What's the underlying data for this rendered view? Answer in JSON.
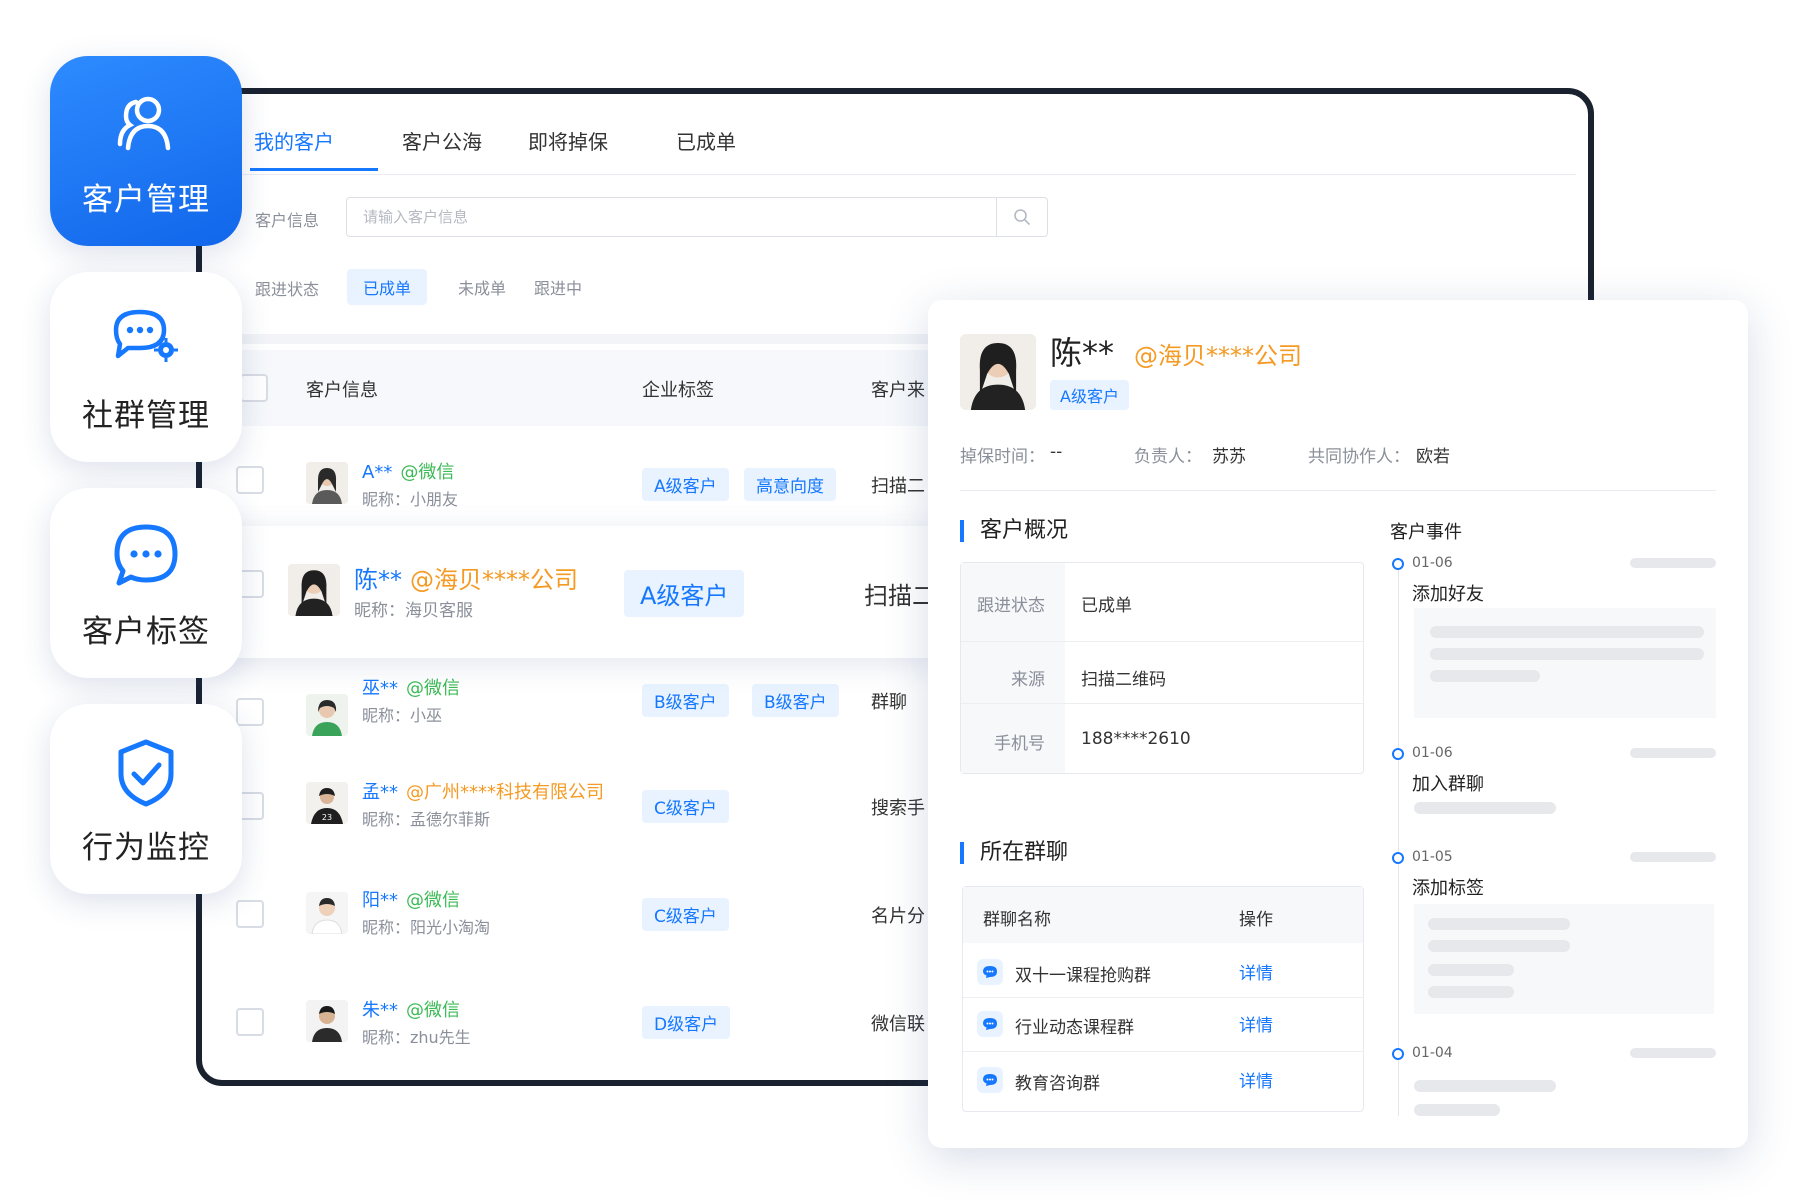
{
  "nav": {
    "items": [
      {
        "label": "客户管理",
        "icon": "customer-manage-icon",
        "active": true
      },
      {
        "label": "社群管理",
        "icon": "community-chat-icon",
        "active": false
      },
      {
        "label": "客户标签",
        "icon": "chat-bubble-icon",
        "active": false
      },
      {
        "label": "行为监控",
        "icon": "shield-check-icon",
        "active": false
      }
    ]
  },
  "tabs": [
    "我的客户",
    "客户公海",
    "即将掉保",
    "已成单"
  ],
  "search": {
    "label": "客户信息",
    "placeholder": "请输入客户信息"
  },
  "filter": {
    "label": "跟进状态",
    "options": [
      "已成单",
      "未成单",
      "跟进中"
    ]
  },
  "table": {
    "headers": [
      "客户信息",
      "企业标签",
      "客户来"
    ],
    "rows": [
      {
        "name": "A**",
        "source": "@微信",
        "nickname": "昵称：小朋友",
        "tags": [
          "A级客户",
          "高意向度"
        ],
        "channel": "扫描二"
      },
      {
        "name": "陈**",
        "source": "@海贝****公司",
        "nickname": "昵称：海贝客服",
        "tags": [
          "A级客户"
        ],
        "channel": "扫描二"
      },
      {
        "name": "巫**",
        "source": "@微信",
        "nickname": "昵称：小巫",
        "tags": [
          "B级客户",
          "B级客户"
        ],
        "channel": "群聊"
      },
      {
        "name": "孟**",
        "source": "@广州****科技有限公司",
        "nickname": "昵称：孟德尔菲斯",
        "tags": [
          "C级客户"
        ],
        "channel": "搜索手"
      },
      {
        "name": "阳**",
        "source": "@微信",
        "nickname": "昵称：阳光小淘淘",
        "tags": [
          "C级客户"
        ],
        "channel": "名片分"
      },
      {
        "name": "朱**",
        "source": "@微信",
        "nickname": "昵称：zhu先生",
        "tags": [
          "D级客户"
        ],
        "channel": "微信联"
      }
    ]
  },
  "detail": {
    "name": "陈**",
    "company": "@海贝****公司",
    "level": "A级客户",
    "meta": [
      {
        "label": "掉保时间：",
        "value": "--"
      },
      {
        "label": "负责人：",
        "value": "苏苏"
      },
      {
        "label": "共同协作人：",
        "value": "欧若"
      }
    ],
    "overview_title": "客户概况",
    "overview": [
      {
        "label": "跟进状态",
        "value": "已成单"
      },
      {
        "label": "来源",
        "value": "扫描二维码"
      },
      {
        "label": "手机号",
        "value": "188****2610"
      }
    ],
    "groups_title": "所在群聊",
    "groups_headers": [
      "群聊名称",
      "操作"
    ],
    "groups": [
      {
        "name": "双十一课程抢购群",
        "action": "详情"
      },
      {
        "name": "行业动态课程群",
        "action": "详情"
      },
      {
        "name": "教育咨询群",
        "action": "详情"
      }
    ],
    "events_title": "客户事件",
    "events": [
      {
        "date": "01-06",
        "title": "添加好友"
      },
      {
        "date": "01-06",
        "title": "加入群聊"
      },
      {
        "date": "01-05",
        "title": "添加标签"
      },
      {
        "date": "01-04",
        "title": ""
      }
    ]
  },
  "colors": {
    "accent": "#1677ff",
    "wechat": "#3cba56",
    "company": "#f59a23",
    "frame": "#1a2230"
  }
}
